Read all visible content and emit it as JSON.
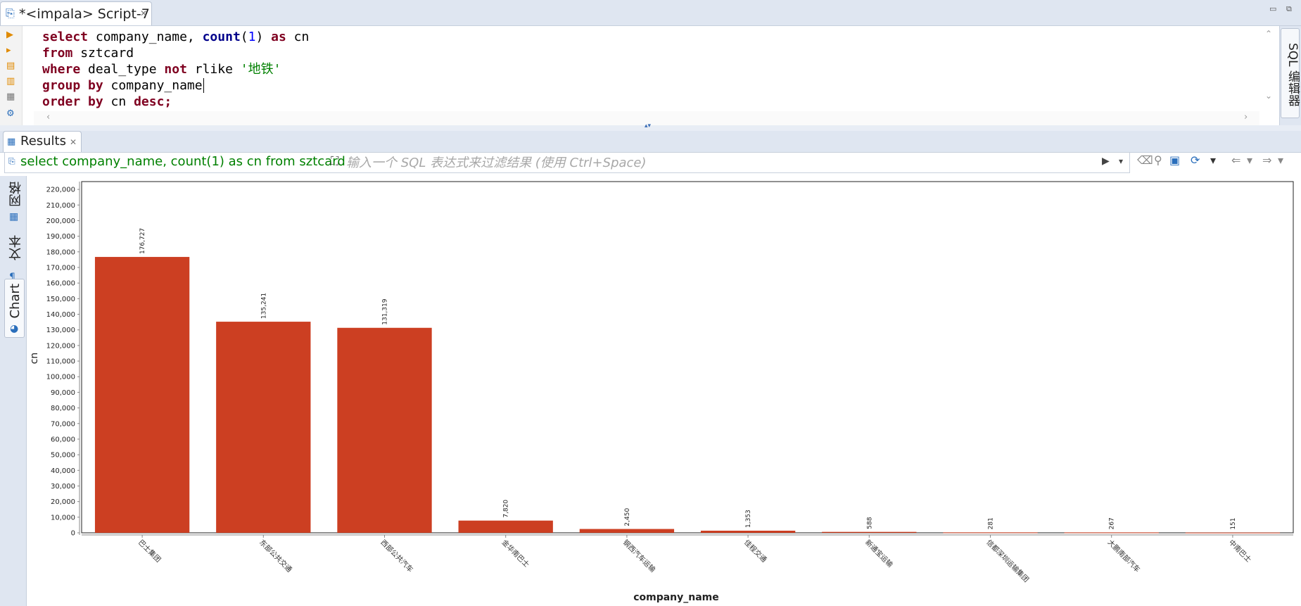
{
  "editor": {
    "tab_label": "*<impala> Script-7",
    "code": [
      [
        {
          "t": "select",
          "c": "kw"
        },
        {
          "t": " company_name, ",
          "c": ""
        },
        {
          "t": "count",
          "c": "fn"
        },
        {
          "t": "(",
          "c": ""
        },
        {
          "t": "1",
          "c": "num"
        },
        {
          "t": ") ",
          "c": ""
        },
        {
          "t": "as",
          "c": "kw"
        },
        {
          "t": " cn",
          "c": ""
        }
      ],
      [
        {
          "t": "from",
          "c": "kw"
        },
        {
          "t": " sztcard",
          "c": ""
        }
      ],
      [
        {
          "t": "where",
          "c": "kw"
        },
        {
          "t": " deal_type ",
          "c": ""
        },
        {
          "t": "not",
          "c": "kw"
        },
        {
          "t": " rlike ",
          "c": ""
        },
        {
          "t": "'地铁'",
          "c": "str"
        }
      ],
      [
        {
          "t": "group",
          "c": "kw"
        },
        {
          "t": " ",
          "c": ""
        },
        {
          "t": "by",
          "c": "kw"
        },
        {
          "t": " company_name",
          "c": ""
        }
      ],
      [
        {
          "t": "order",
          "c": "kw"
        },
        {
          "t": " ",
          "c": ""
        },
        {
          "t": "by",
          "c": "kw"
        },
        {
          "t": " cn ",
          "c": ""
        },
        {
          "t": "desc;",
          "c": "kw"
        }
      ]
    ],
    "right_rail_label": "SQL 编辑器"
  },
  "results": {
    "tab_label": "Results",
    "query_text": "select company_name, count(1) as cn from sztcard",
    "filter_placeholder": "输入一个 SQL 表达式来过滤结果 (使用 Ctrl+Space)"
  },
  "view_tabs": {
    "grid": "网格",
    "text": "文本",
    "chart": "Chart"
  },
  "colors": {
    "bar": "#cc3f22",
    "keyword": "#7f0020",
    "string": "#008000",
    "accent": "#2a6ebb"
  },
  "chart_data": {
    "type": "bar",
    "xlabel": "company_name",
    "ylabel": "cn",
    "ylim": [
      0,
      225000
    ],
    "ytick_step": 10000,
    "categories": [
      "巴士集团",
      "东部公共交通",
      "西部公共汽车",
      "金华南巴士",
      "钢西汽车运输",
      "佳程交通",
      "新通宝运输",
      "信都深圳运输集团",
      "大鹏南部汽车",
      "中南巴士"
    ],
    "values": [
      176727,
      135241,
      131319,
      7820,
      2450,
      1353,
      588,
      281,
      267,
      151
    ],
    "value_labels": [
      "176,727",
      "135,241",
      "131,319",
      "7,820",
      "2,450",
      "1,353",
      "588",
      "281",
      "267",
      "151"
    ],
    "ytick_labels": [
      "0",
      "10,000",
      "20,000",
      "30,000",
      "40,000",
      "50,000",
      "60,000",
      "70,000",
      "80,000",
      "90,000",
      "100,000",
      "110,000",
      "120,000",
      "130,000",
      "140,000",
      "150,000",
      "160,000",
      "170,000",
      "180,000",
      "190,000",
      "200,000",
      "210,000",
      "220,000"
    ]
  }
}
